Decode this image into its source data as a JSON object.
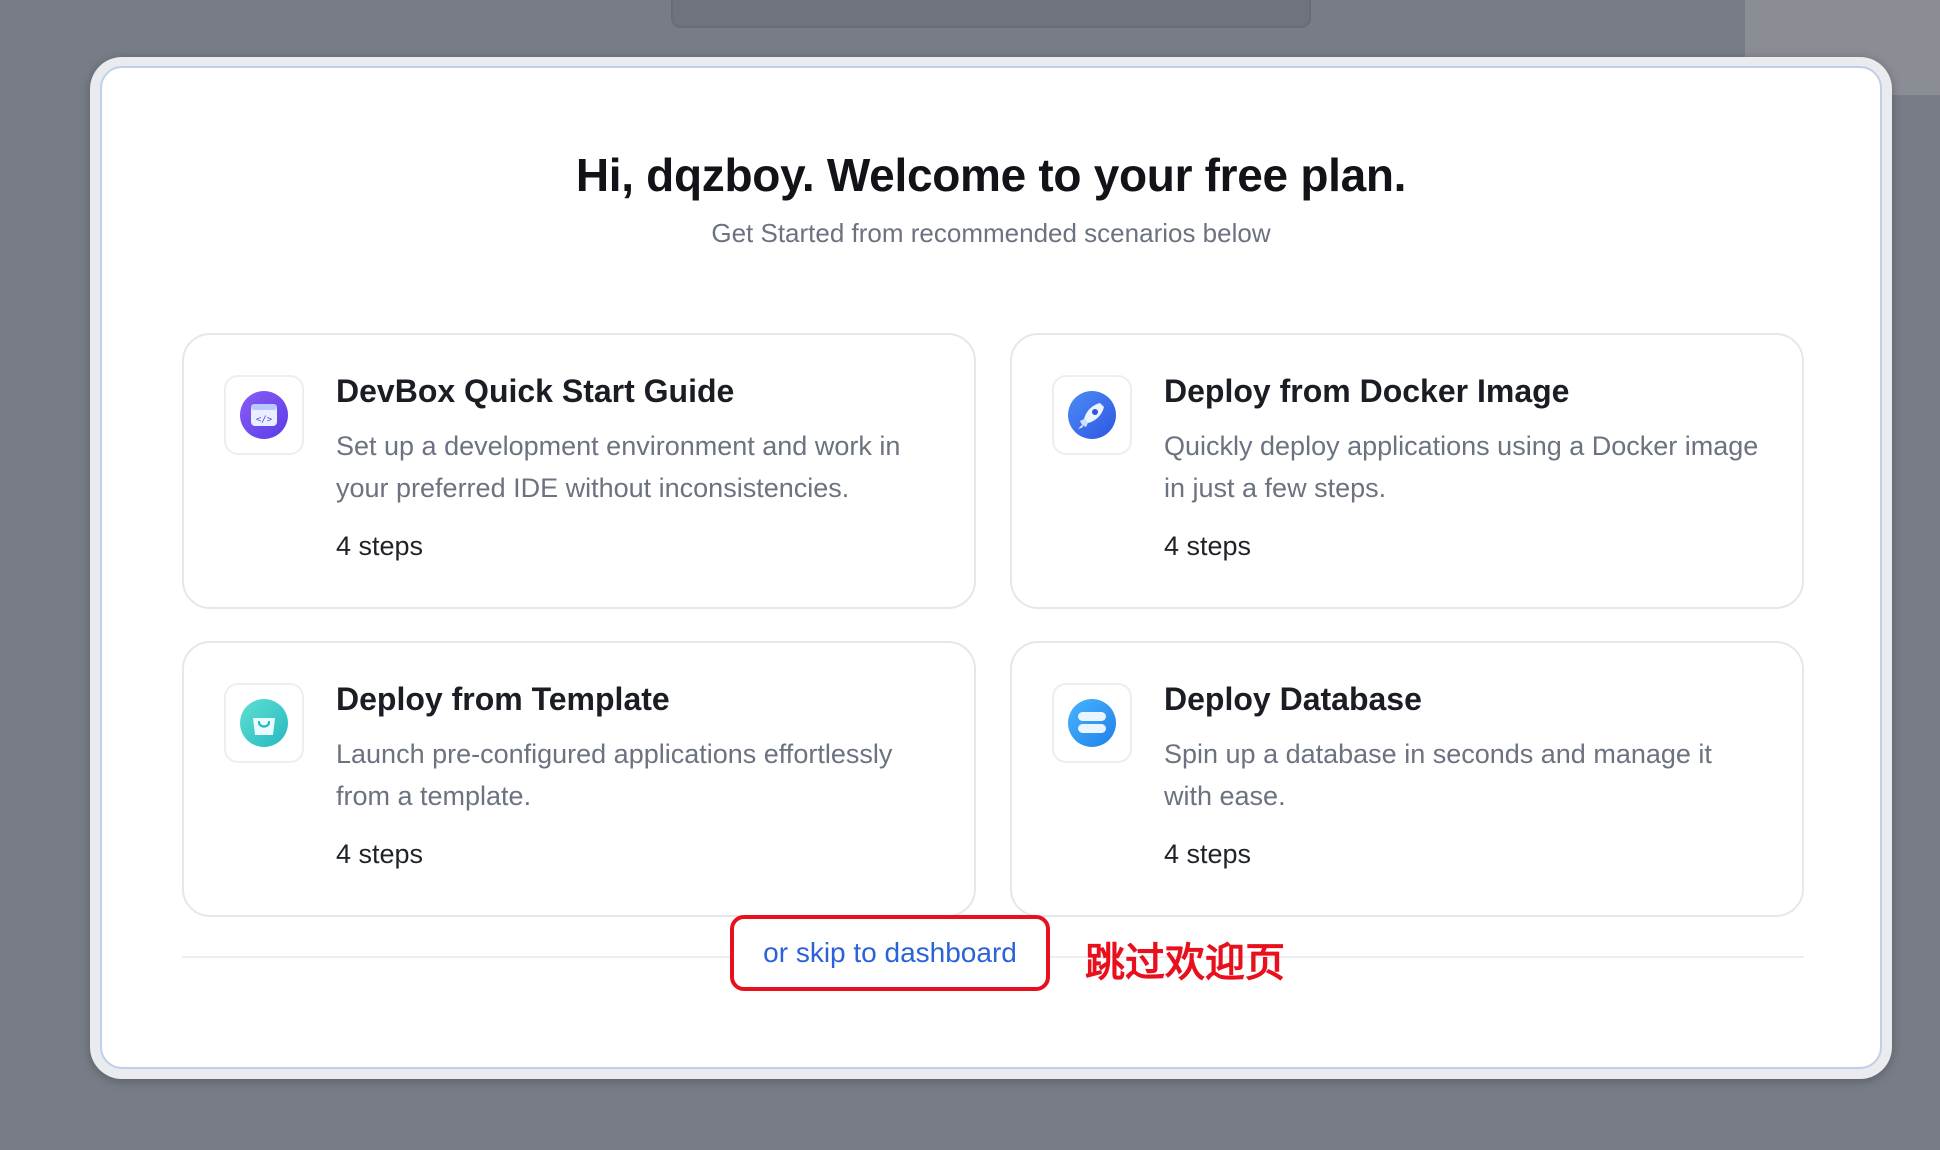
{
  "header": {
    "title": "Hi, dqzboy. Welcome to your free plan.",
    "subtitle": "Get Started from recommended scenarios below"
  },
  "cards": [
    {
      "title": "DevBox Quick Start Guide",
      "description": "Set up a development environment and work in your preferred IDE without inconsistencies.",
      "steps": "4 steps",
      "icon": "devbox-icon",
      "color": "#6c4cf0"
    },
    {
      "title": "Deploy from Docker Image",
      "description": "Quickly deploy applications using a Docker image in just a few steps.",
      "steps": "4 steps",
      "icon": "rocket-icon",
      "color": "#3a6ff0"
    },
    {
      "title": "Deploy from Template",
      "description": "Launch pre-configured applications effortlessly from a template.",
      "steps": "4 steps",
      "icon": "shopping-bag-icon",
      "color": "#3fd0c8"
    },
    {
      "title": "Deploy Database",
      "description": "Spin up a database in seconds and manage it with ease.",
      "steps": "4 steps",
      "icon": "database-icon",
      "color": "#2e9bf5"
    }
  ],
  "footer": {
    "skip_label": "or skip to dashboard",
    "annotation": "跳过欢迎页"
  },
  "colors": {
    "link": "#2a63d9",
    "annotation_red": "#e8101c",
    "overlay": "#787c86"
  }
}
